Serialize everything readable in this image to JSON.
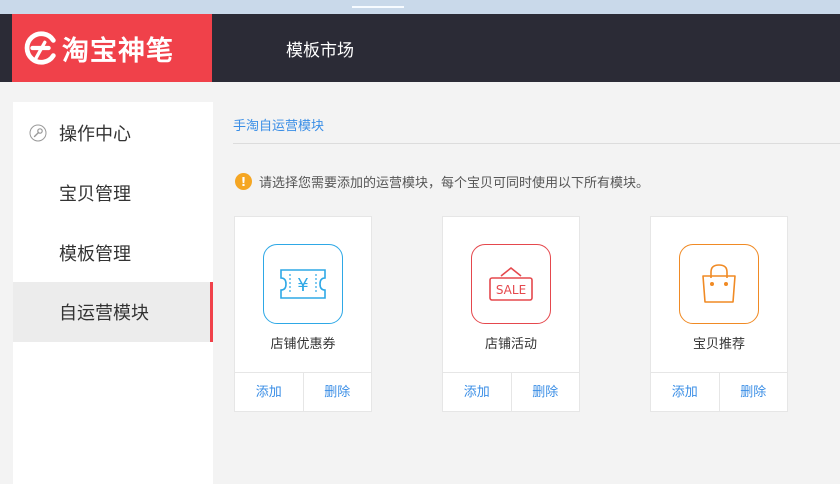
{
  "header": {
    "logo_text": "淘宝神笔",
    "nav_market": "模板市场"
  },
  "sidebar": {
    "items": [
      {
        "label": "操作中心",
        "active": false
      },
      {
        "label": "宝贝管理",
        "active": false
      },
      {
        "label": "模板管理",
        "active": false
      },
      {
        "label": "自运营模块",
        "active": true
      }
    ]
  },
  "main": {
    "breadcrumb": "手淘自运营模块",
    "notice_icon": "!",
    "notice": "请选择您需要添加的运营模块，每个宝贝可同时使用以下所有模块。",
    "sale_text": "SALE",
    "yen_text": "¥",
    "cards": [
      {
        "name": "店铺优惠券",
        "icon": "coupon-icon",
        "color": "#2ea8e6",
        "add_label": "添加",
        "delete_label": "删除"
      },
      {
        "name": "店铺活动",
        "icon": "sale-icon",
        "color": "#e5484d",
        "add_label": "添加",
        "delete_label": "删除"
      },
      {
        "name": "宝贝推荐",
        "icon": "shopping-bag-icon",
        "color": "#f08a24",
        "add_label": "添加",
        "delete_label": "删除"
      }
    ]
  },
  "colors": {
    "brand_red": "#f0414a",
    "header_dark": "#2b2b36",
    "link_blue": "#3a8ee6",
    "warning": "#f5a623"
  }
}
